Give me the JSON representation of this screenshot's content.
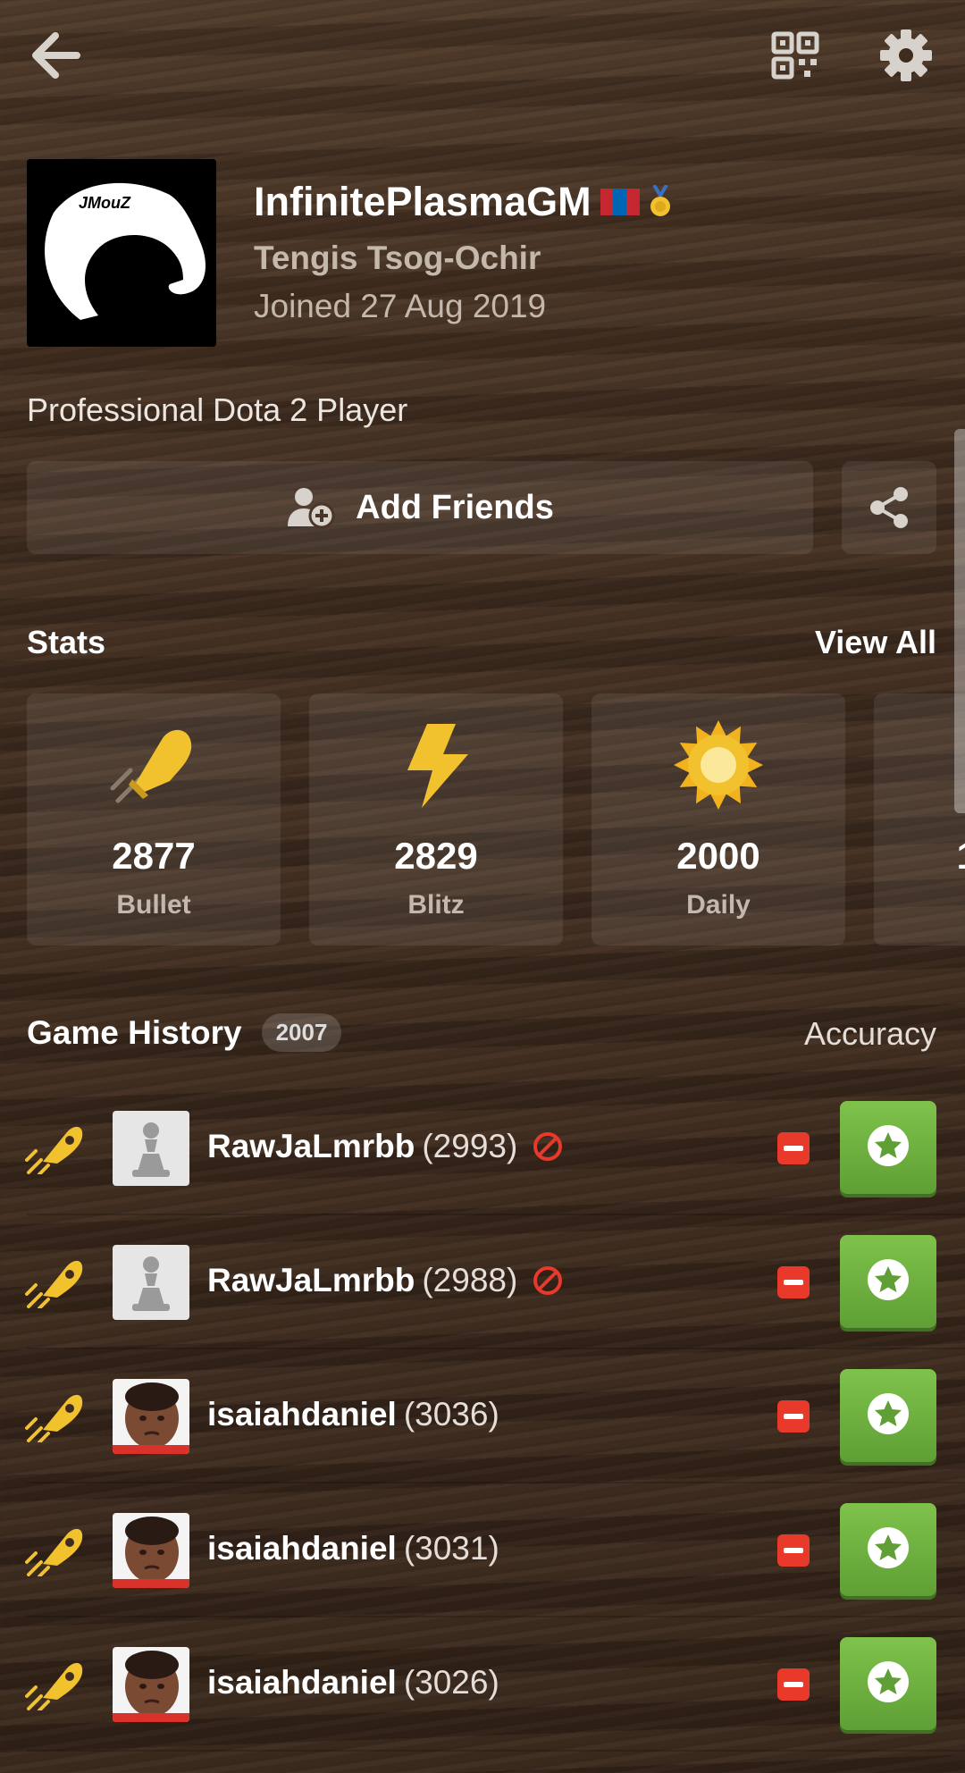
{
  "colors": {
    "accent_green": "#6aad3d",
    "loss_red": "#e8392a",
    "icon_gold": "#f2c12e",
    "muted_text": "#c4b8ac"
  },
  "profile": {
    "username": "InfinitePlasmaGM",
    "real_name": "Tengis Tsog-Ochir",
    "joined": "Joined 27 Aug 2019",
    "bio": "Professional Dota 2 Player",
    "avatar_text": "JMouZ",
    "flag": "mongolia-flag-icon"
  },
  "actions": {
    "add_friends_label": "Add Friends"
  },
  "stats": {
    "title": "Stats",
    "view_all": "View All",
    "cards": [
      {
        "value": "2877",
        "label": "Bullet",
        "icon": "bullet-icon"
      },
      {
        "value": "2829",
        "label": "Blitz",
        "icon": "lightning-icon"
      },
      {
        "value": "2000",
        "label": "Daily",
        "icon": "sun-icon"
      },
      {
        "value": "1",
        "label": "",
        "icon": "partial-card"
      }
    ]
  },
  "game_history": {
    "title": "Game History",
    "count": "2007",
    "accuracy_label": "Accuracy",
    "games": [
      {
        "opponent": "RawJaLmrbb",
        "rating": "(2993)",
        "blocked": true,
        "avatar": "pawn-avatar"
      },
      {
        "opponent": "RawJaLmrbb",
        "rating": "(2988)",
        "blocked": true,
        "avatar": "pawn-avatar"
      },
      {
        "opponent": "isaiahdaniel",
        "rating": "(3036)",
        "blocked": false,
        "avatar": "photo-avatar"
      },
      {
        "opponent": "isaiahdaniel",
        "rating": "(3031)",
        "blocked": false,
        "avatar": "photo-avatar"
      },
      {
        "opponent": "isaiahdaniel",
        "rating": "(3026)",
        "blocked": false,
        "avatar": "photo-avatar"
      }
    ]
  }
}
